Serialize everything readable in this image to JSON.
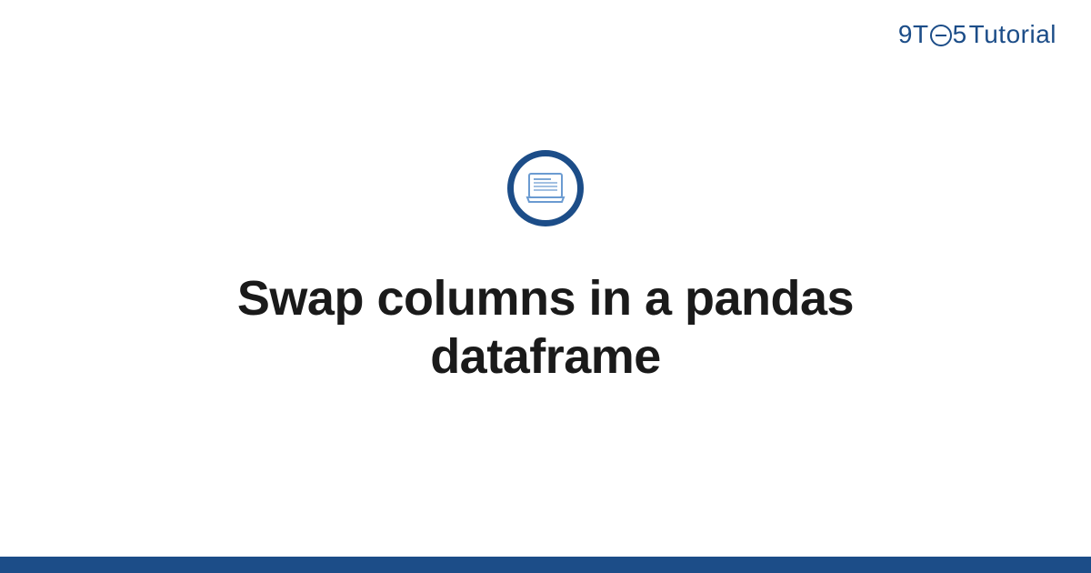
{
  "logo": {
    "part1": "9",
    "part2": "T",
    "part3": "5",
    "tutorial": "Tutorial"
  },
  "title": "Swap columns in a pandas dataframe",
  "colors": {
    "brand": "#1c4d88",
    "text": "#1a1a1a"
  }
}
